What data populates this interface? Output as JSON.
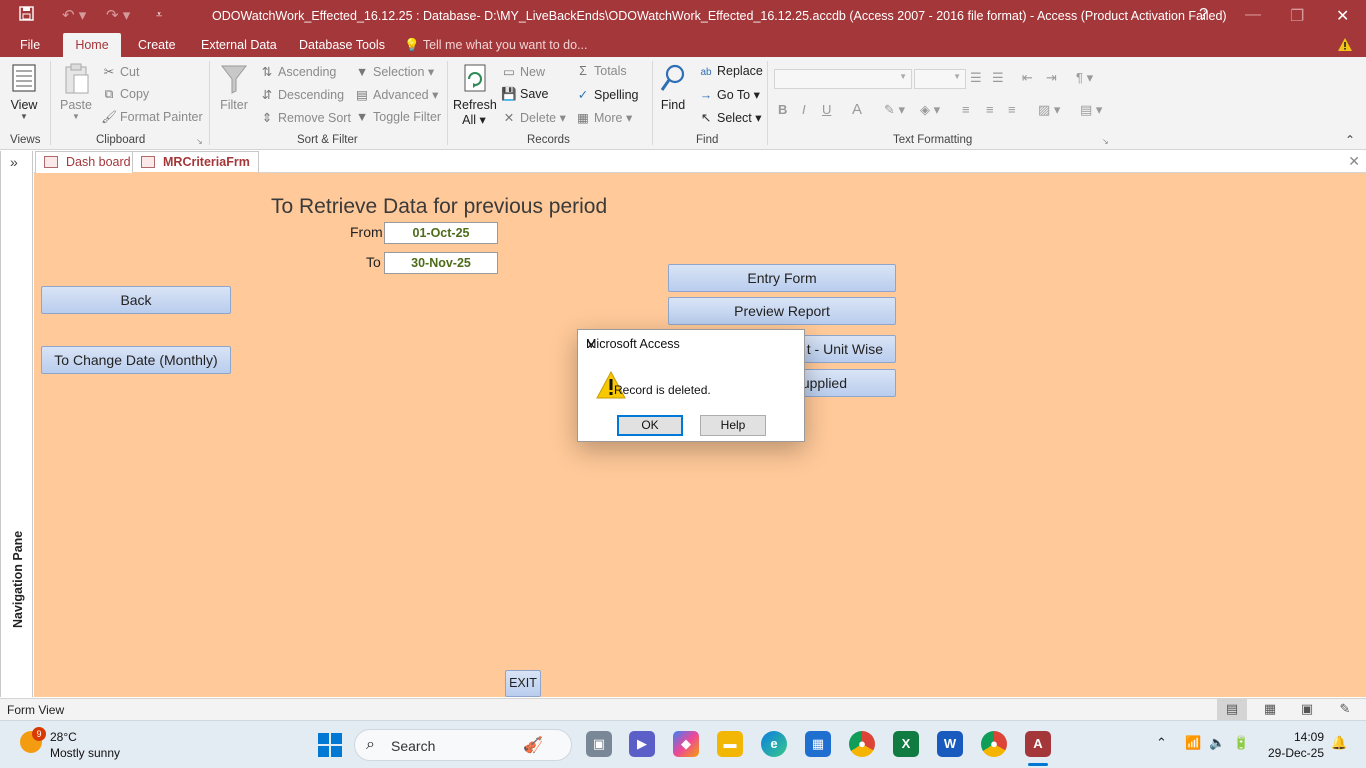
{
  "window": {
    "title": "ODOWatchWork_Effected_16.12.25 : Database- D:\\MY_LiveBackEnds\\ODOWatchWork_Effected_16.12.25.accdb (Access 2007 - 2016 file format) - Access (Product Activation Failed)",
    "help": "?"
  },
  "ribbon_tabs": [
    "File",
    "Home",
    "Create",
    "External Data",
    "Database Tools"
  ],
  "tell_me": "Tell me what you want to do...",
  "ribbon": {
    "views": {
      "view": "View",
      "label": "Views"
    },
    "clipboard": {
      "paste": "Paste",
      "cut": "Cut",
      "copy": "Copy",
      "format_painter": "Format Painter",
      "label": "Clipboard"
    },
    "sort_filter": {
      "filter": "Filter",
      "ascending": "Ascending",
      "descending": "Descending",
      "remove_sort": "Remove Sort",
      "selection": "Selection",
      "advanced": "Advanced",
      "toggle_filter": "Toggle Filter",
      "label": "Sort & Filter"
    },
    "records": {
      "refresh": "Refresh",
      "refresh2": "All",
      "new": "New",
      "save": "Save",
      "delete": "Delete",
      "totals": "Totals",
      "spelling": "Spelling",
      "more": "More",
      "label": "Records"
    },
    "find": {
      "find": "Find",
      "replace": "Replace",
      "goto": "Go To",
      "select": "Select",
      "label": "Find"
    },
    "text_formatting": {
      "label": "Text Formatting",
      "bold": "B",
      "italic": "I",
      "underline": "U",
      "font_color": "A"
    }
  },
  "nav_pane": {
    "label": "Navigation Pane"
  },
  "doc_tabs": [
    {
      "label": "Dash board",
      "active": false
    },
    {
      "label": "MRCriteriaFrm",
      "active": true
    }
  ],
  "form": {
    "title": "To Retrieve Data for previous period",
    "from_label": "From",
    "from_value": "01-Oct-25",
    "to_label": "To",
    "to_value": "30-Nov-25",
    "back": "Back",
    "change_date": "To Change Date (Monthly)",
    "entry_form": "Entry Form",
    "preview_report": "Preview Report",
    "report_unit_wise": "t - Unit Wise",
    "supplied": "upplied",
    "exit": "EXIT"
  },
  "dialog": {
    "title": "Microsoft Access",
    "message": "Record is deleted.",
    "ok": "OK",
    "help": "Help"
  },
  "status": {
    "text": "Form View"
  },
  "taskbar": {
    "weather_temp": "28°C",
    "weather_cond": "Mostly sunny",
    "weather_badge": "9",
    "search": "Search",
    "time": "14:09",
    "date": "29-Dec-25"
  },
  "colors": {
    "accent": "#a4373a",
    "form_background": "#ffc999",
    "button_blue": "#c9d9f2",
    "field_text": "#4e6b1a"
  }
}
